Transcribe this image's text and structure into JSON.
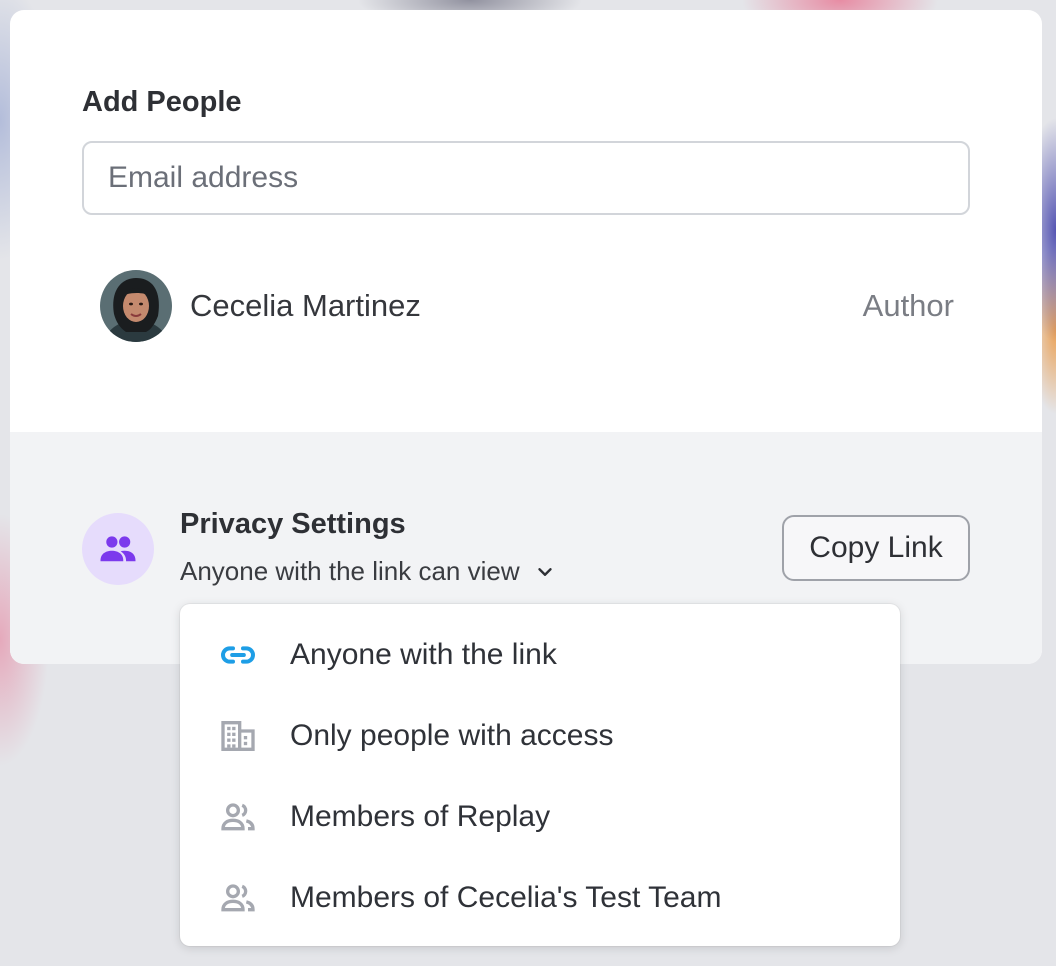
{
  "add_people": {
    "title": "Add People",
    "email_placeholder": "Email address"
  },
  "collaborators": [
    {
      "name": "Cecelia Martinez",
      "role": "Author",
      "avatar_icon": "user-avatar-photo"
    }
  ],
  "privacy": {
    "title": "Privacy Settings",
    "current": "Anyone with the link can view",
    "icon": "people-icon",
    "accent_color": "#7c3aed",
    "icon_bg_color": "#e6dcfc"
  },
  "copy_link_label": "Copy Link",
  "menu": {
    "items": [
      {
        "label": "Anyone with the link",
        "icon": "link-icon",
        "icon_color": "#1e9ee6"
      },
      {
        "label": "Only people with access",
        "icon": "building-icon",
        "icon_color": "#a5a8b0"
      },
      {
        "label": "Members of Replay",
        "icon": "people-icon",
        "icon_color": "#a5a8b0"
      },
      {
        "label": "Members of Cecelia's Test Team",
        "icon": "people-icon",
        "icon_color": "#a5a8b0"
      }
    ]
  }
}
